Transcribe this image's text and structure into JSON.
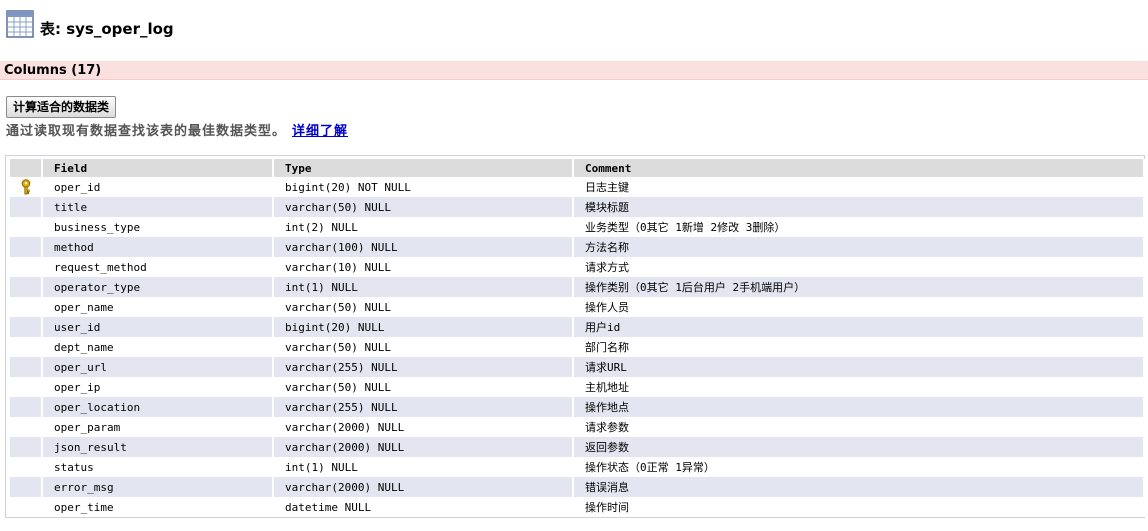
{
  "header": {
    "title": "表: sys_oper_log",
    "icon": "table-grid-icon"
  },
  "section": {
    "title": "Columns (17)"
  },
  "analyze": {
    "button_label": "计算适合的数据类",
    "description": "通过读取现有数据查找该表的最佳数据类型。",
    "link_label": "详细了解"
  },
  "columns_table": {
    "headers": [
      "Field",
      "Type",
      "Comment"
    ],
    "rows": [
      {
        "key": true,
        "field": "oper_id",
        "type": "bigint(20) NOT NULL",
        "comment": "日志主键"
      },
      {
        "key": false,
        "field": "title",
        "type": "varchar(50) NULL",
        "comment": "模块标题"
      },
      {
        "key": false,
        "field": "business_type",
        "type": "int(2) NULL",
        "comment": "业务类型（0其它 1新增 2修改 3删除）"
      },
      {
        "key": false,
        "field": "method",
        "type": "varchar(100) NULL",
        "comment": "方法名称"
      },
      {
        "key": false,
        "field": "request_method",
        "type": "varchar(10) NULL",
        "comment": "请求方式"
      },
      {
        "key": false,
        "field": "operator_type",
        "type": "int(1) NULL",
        "comment": "操作类别（0其它 1后台用户 2手机端用户）"
      },
      {
        "key": false,
        "field": "oper_name",
        "type": "varchar(50) NULL",
        "comment": "操作人员"
      },
      {
        "key": false,
        "field": "user_id",
        "type": "bigint(20) NULL",
        "comment": "用户id"
      },
      {
        "key": false,
        "field": "dept_name",
        "type": "varchar(50) NULL",
        "comment": "部门名称"
      },
      {
        "key": false,
        "field": "oper_url",
        "type": "varchar(255) NULL",
        "comment": "请求URL"
      },
      {
        "key": false,
        "field": "oper_ip",
        "type": "varchar(50) NULL",
        "comment": "主机地址"
      },
      {
        "key": false,
        "field": "oper_location",
        "type": "varchar(255) NULL",
        "comment": "操作地点"
      },
      {
        "key": false,
        "field": "oper_param",
        "type": "varchar(2000) NULL",
        "comment": "请求参数"
      },
      {
        "key": false,
        "field": "json_result",
        "type": "varchar(2000) NULL",
        "comment": "返回参数"
      },
      {
        "key": false,
        "field": "status",
        "type": "int(1) NULL",
        "comment": "操作状态（0正常 1异常）"
      },
      {
        "key": false,
        "field": "error_msg",
        "type": "varchar(2000) NULL",
        "comment": "错误消息"
      },
      {
        "key": false,
        "field": "oper_time",
        "type": "datetime NULL",
        "comment": "操作时间"
      }
    ]
  },
  "colors": {
    "section_bar": "#fbe0e0",
    "header_row": "#dcdcdc",
    "alt_row": "#e3e6f0",
    "link": "#0000cc",
    "key_icon": "#d9a300"
  }
}
